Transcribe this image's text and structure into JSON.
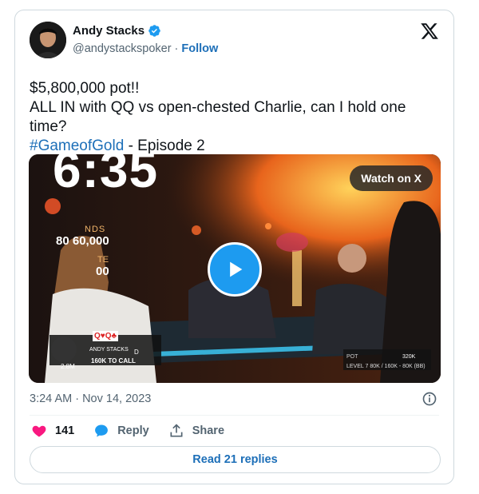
{
  "author": {
    "name": "Andy Stacks",
    "handle": "@andystackspoker",
    "separator": "·",
    "follow_label": "Follow",
    "verified": true
  },
  "icons": {
    "brand": "x-logo-icon",
    "verified": "verified-badge-icon",
    "play": "play-icon",
    "info": "info-icon",
    "like": "heart-icon",
    "reply": "reply-bubble-icon",
    "share": "share-icon"
  },
  "tweet": {
    "line1": "$5,800,000 pot!!",
    "line2": "ALL IN with QQ vs open-chested Charlie, can I hold one time?",
    "hashtag": "#GameofGold",
    "line3_rest": " - Episode 2"
  },
  "media": {
    "watch_label": "Watch on X",
    "overlay": {
      "clock": "6:35",
      "blinds_label": "NDS",
      "blinds": "80   60,000",
      "ante_label": "TE",
      "ante": "00",
      "player_cards": "Q♥Q♣",
      "player_name": "ANDY STACKS",
      "dealer": "D",
      "player_chips": "2.8M",
      "to_call": "160K TO CALL",
      "pot_label": "POT",
      "pot_value": "320K",
      "level": "LEVEL 7   80K / 160K - 80K (BB)"
    }
  },
  "meta": {
    "timestamp": "3:24 AM · Nov 14, 2023"
  },
  "actions": {
    "likes": "141",
    "reply_label": "Reply",
    "share_label": "Share"
  },
  "footer": {
    "read_replies": "Read 21 replies"
  },
  "colors": {
    "link": "#1d6fb8",
    "verified": "#1d9bf0",
    "like": "#f91880",
    "play": "#1d9bf0"
  }
}
